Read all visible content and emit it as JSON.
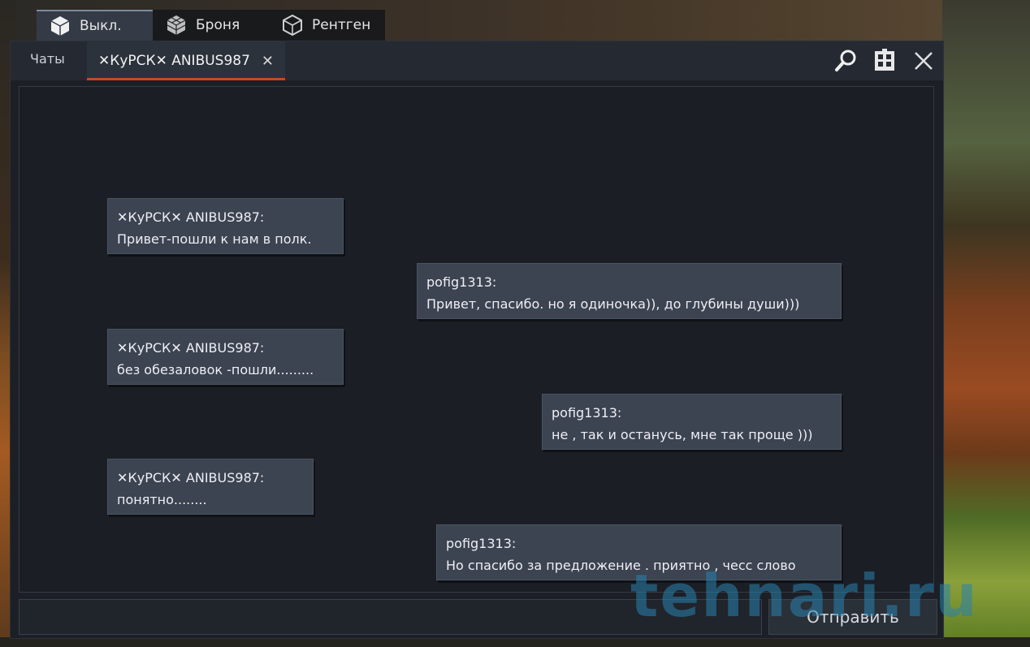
{
  "mode_tabs": [
    {
      "label": "Выкл.",
      "icon": "cube-solid-icon",
      "active": true
    },
    {
      "label": "Броня",
      "icon": "cube-armor-icon",
      "active": false
    },
    {
      "label": "Рентген",
      "icon": "cube-xray-icon",
      "active": false
    }
  ],
  "chat": {
    "tabs_label": "Чаты",
    "active_tab": "✕КуРСК✕ ANIBUS987",
    "close_symbol": "✕",
    "toolbar_icons": [
      "search-icon",
      "squad-icon",
      "close-icon"
    ],
    "messages": [
      {
        "author": "✕КуРСК✕ ANIBUS987:",
        "text": "Привет-пошли к нам в полк.",
        "side": "left"
      },
      {
        "author": "pofig1313:",
        "text": "Привет, спасибо. но я одиночка)), до глубины души)))",
        "side": "right"
      },
      {
        "author": "✕КуРСК✕ ANIBUS987:",
        "text": "без обезаловок -пошли.........",
        "side": "left"
      },
      {
        "author": "pofig1313:",
        "text": "не , так и останусь, мне так проще )))",
        "side": "right"
      },
      {
        "author": "✕КуРСК✕ ANIBUS987:",
        "text": "понятно........",
        "side": "left"
      },
      {
        "author": "pofig1313:",
        "text": "Но спасибо за предложение . приятно , чесс слово",
        "side": "right"
      }
    ],
    "input_value": "",
    "send_label": "Отправить"
  },
  "watermark": "tehnari.ru",
  "colors": {
    "accent_underline": "#c24a24",
    "bubble_bg": "#3b4450",
    "window_bg": "#1b1e24"
  }
}
